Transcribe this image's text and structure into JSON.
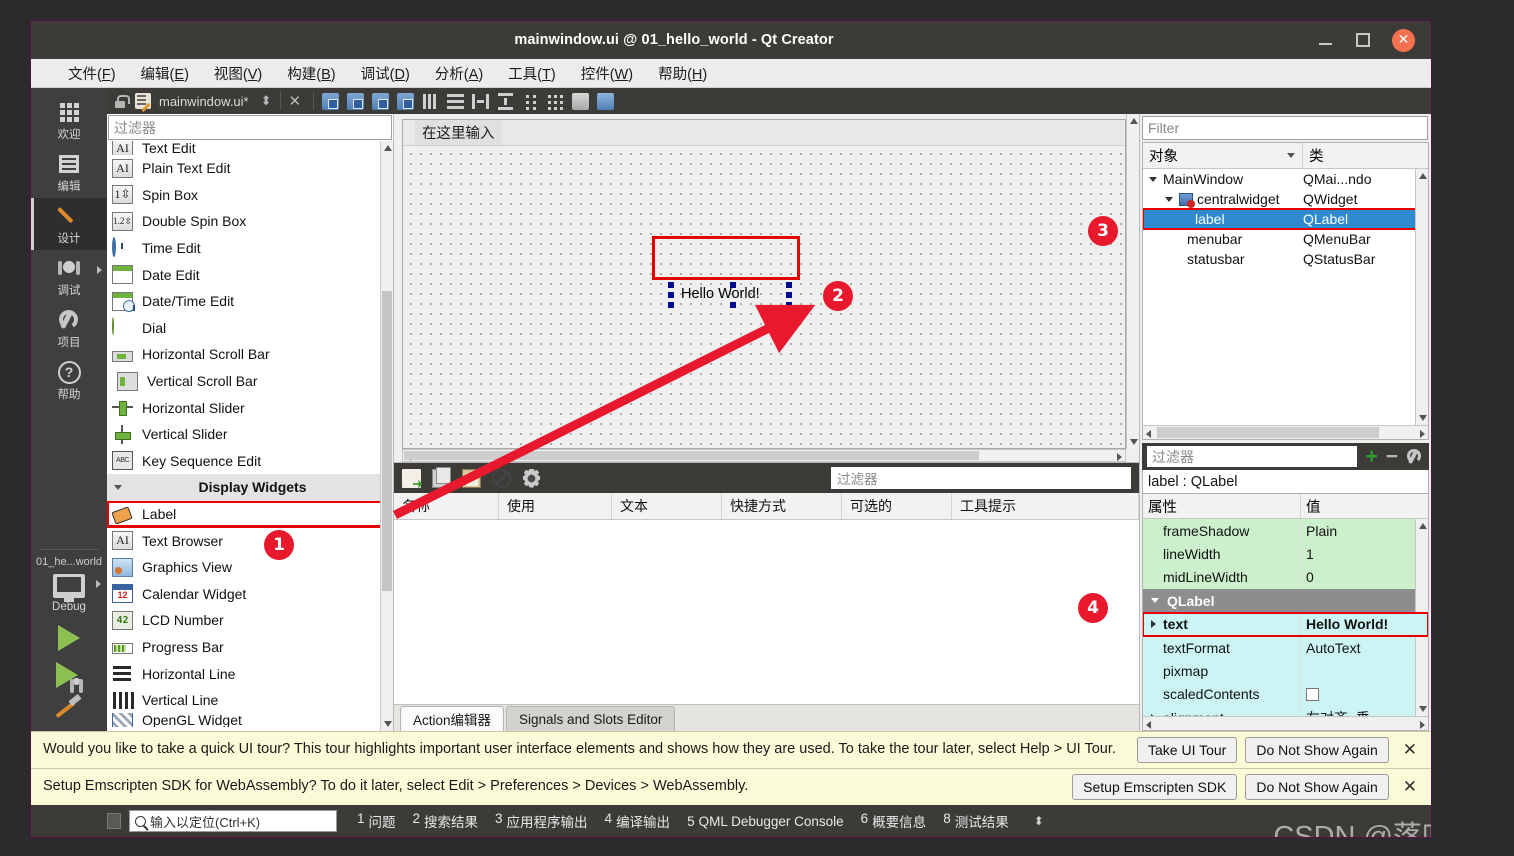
{
  "window": {
    "title": "mainwindow.ui @ 01_hello_world - Qt Creator",
    "minimize": "—",
    "maximize": "□",
    "close": "✕"
  },
  "menubar": [
    {
      "label": "文件",
      "key": "F"
    },
    {
      "label": "编辑",
      "key": "E"
    },
    {
      "label": "视图",
      "key": "V"
    },
    {
      "label": "构建",
      "key": "B"
    },
    {
      "label": "调试",
      "key": "D"
    },
    {
      "label": "分析",
      "key": "A"
    },
    {
      "label": "工具",
      "key": "T"
    },
    {
      "label": "控件",
      "key": "W"
    },
    {
      "label": "帮助",
      "key": "H"
    }
  ],
  "modebar": {
    "modes": [
      {
        "label": "欢迎",
        "icon": "grid-icon",
        "active": false
      },
      {
        "label": "编辑",
        "icon": "document-icon",
        "active": false
      },
      {
        "label": "设计",
        "icon": "pencil-icon",
        "active": true
      },
      {
        "label": "调试",
        "icon": "bug-icon",
        "active": false,
        "arrow": true
      },
      {
        "label": "项目",
        "icon": "wrench-icon",
        "active": false
      },
      {
        "label": "帮助",
        "icon": "question-icon",
        "active": false
      }
    ],
    "kit_project": "01_he...world",
    "kit_config": "Debug",
    "run_icon": "run-triangle-icon",
    "debug_icon": "debug-run-icon",
    "build_icon": "hammer-icon"
  },
  "editor_tab": {
    "lock_icon": "unlocked-icon",
    "file_icon": "ui-file-icon",
    "filename": "mainwindow.ui*",
    "split_icon": "▲▼",
    "close_icon": "✕"
  },
  "widget_box": {
    "filter_placeholder": "过滤器",
    "items": [
      {
        "label": "Text Edit",
        "icon": "text-edit-icon",
        "partial": true
      },
      {
        "label": "Plain Text Edit",
        "icon": "plain-text-edit-icon"
      },
      {
        "label": "Spin Box",
        "icon": "spin-box-icon"
      },
      {
        "label": "Double Spin Box",
        "icon": "double-spin-box-icon"
      },
      {
        "label": "Time Edit",
        "icon": "time-edit-icon"
      },
      {
        "label": "Date Edit",
        "icon": "date-edit-icon"
      },
      {
        "label": "Date/Time Edit",
        "icon": "date-time-edit-icon"
      },
      {
        "label": "Dial",
        "icon": "dial-icon"
      },
      {
        "label": "Horizontal Scroll Bar",
        "icon": "horizontal-scroll-bar-icon"
      },
      {
        "label": "Vertical Scroll Bar",
        "icon": "vertical-scroll-bar-icon"
      },
      {
        "label": "Horizontal Slider",
        "icon": "horizontal-slider-icon"
      },
      {
        "label": "Vertical Slider",
        "icon": "vertical-slider-icon"
      },
      {
        "label": "Key Sequence Edit",
        "icon": "key-sequence-edit-icon"
      },
      {
        "label": "Display Widgets",
        "category": true
      },
      {
        "label": "Label",
        "icon": "label-icon",
        "selected": true
      },
      {
        "label": "Text Browser",
        "icon": "text-browser-icon"
      },
      {
        "label": "Graphics View",
        "icon": "graphics-view-icon"
      },
      {
        "label": "Calendar Widget",
        "icon": "calendar-widget-icon"
      },
      {
        "label": "LCD Number",
        "icon": "lcd-number-icon"
      },
      {
        "label": "Progress Bar",
        "icon": "progress-bar-icon"
      },
      {
        "label": "Horizontal Line",
        "icon": "horizontal-line-icon"
      },
      {
        "label": "Vertical Line",
        "icon": "vertical-line-icon"
      },
      {
        "label": "OpenGL Widget",
        "icon": "opengl-widget-icon"
      }
    ]
  },
  "canvas": {
    "menu_placeholder": "在这里输入",
    "label_text": "Hello World!"
  },
  "action_editor": {
    "filter_placeholder": "过滤器",
    "toolbar_icons": [
      "new-action-icon",
      "copy-icon",
      "paste-icon",
      "delete-icon",
      "settings-icon"
    ],
    "columns": [
      "名称",
      "使用",
      "文本",
      "快捷方式",
      "可选的",
      "工具提示"
    ],
    "rows": []
  },
  "bottom_tabs": [
    {
      "label": "Action编辑器",
      "active": true
    },
    {
      "label": "Signals and Slots Editor",
      "active": false
    }
  ],
  "object_tree": {
    "filter_placeholder": "Filter",
    "columns": [
      "对象",
      "类"
    ],
    "rows": [
      {
        "name": "MainWindow",
        "class": "QMai...ndo",
        "depth": 0,
        "expander": true,
        "selected": false
      },
      {
        "name": "centralwidget",
        "class": "QWidget",
        "depth": 1,
        "expander": true,
        "icon": "central-widget-icon",
        "selected": false
      },
      {
        "name": "label",
        "class": "QLabel",
        "depth": 2,
        "selected": true
      },
      {
        "name": "menubar",
        "class": "QMenuBar",
        "depth": 2,
        "selected": false
      },
      {
        "name": "statusbar",
        "class": "QStatusBar",
        "depth": 2,
        "selected": false
      }
    ]
  },
  "property_editor": {
    "filter_placeholder": "过滤器",
    "add_icon": "plus-icon",
    "remove_icon": "minus-icon",
    "configure_icon": "wrench-icon",
    "object_header": "label : QLabel",
    "columns": [
      "属性",
      "值"
    ],
    "rows": [
      {
        "name": "frameShadow",
        "value": "Plain",
        "style": "green"
      },
      {
        "name": "lineWidth",
        "value": "1",
        "style": "green"
      },
      {
        "name": "midLineWidth",
        "value": "0",
        "style": "green"
      },
      {
        "name": "QLabel",
        "value": "",
        "style": "group"
      },
      {
        "name": "text",
        "value": "Hello World!",
        "style": "cyan",
        "selected": true,
        "expander": true
      },
      {
        "name": "textFormat",
        "value": "AutoText",
        "style": "cyan"
      },
      {
        "name": "pixmap",
        "value": "",
        "style": "cyan"
      },
      {
        "name": "scaledContents",
        "value": "",
        "style": "cyan",
        "checkbox": true
      },
      {
        "name": "alignment",
        "value": "左对齐, 垂...",
        "style": "cyan",
        "expander": true
      }
    ]
  },
  "notifications": [
    {
      "message": "Would you like to take a quick UI tour? This tour highlights important user interface elements and shows how they are used. To take the tour later, select Help > UI Tour.",
      "buttons": [
        "Take UI Tour",
        "Do Not Show Again"
      ],
      "close": "✕"
    },
    {
      "message": "Setup Emscripten SDK for WebAssembly? To do it later, select Edit > Preferences > Devices > WebAssembly.",
      "buttons": [
        "Setup Emscripten SDK",
        "Do Not Show Again"
      ],
      "close": "✕"
    }
  ],
  "statusbar": {
    "locator_placeholder": "输入以定位(Ctrl+K)",
    "search_icon": "magnifier-icon",
    "panes": [
      {
        "num": "1",
        "label": "问题"
      },
      {
        "num": "2",
        "label": "搜索结果"
      },
      {
        "num": "3",
        "label": "应用程序输出"
      },
      {
        "num": "4",
        "label": "编译输出"
      },
      {
        "num": "5",
        "label": "QML Debugger Console"
      },
      {
        "num": "6",
        "label": "概要信息"
      },
      {
        "num": "8",
        "label": "测试结果"
      }
    ],
    "more_arrow": "▲▼"
  },
  "annotations": {
    "badges": [
      "1",
      "2",
      "3",
      "4"
    ],
    "accent_color": "#e8192c"
  },
  "watermark": "CSDN @落叶霜霜"
}
